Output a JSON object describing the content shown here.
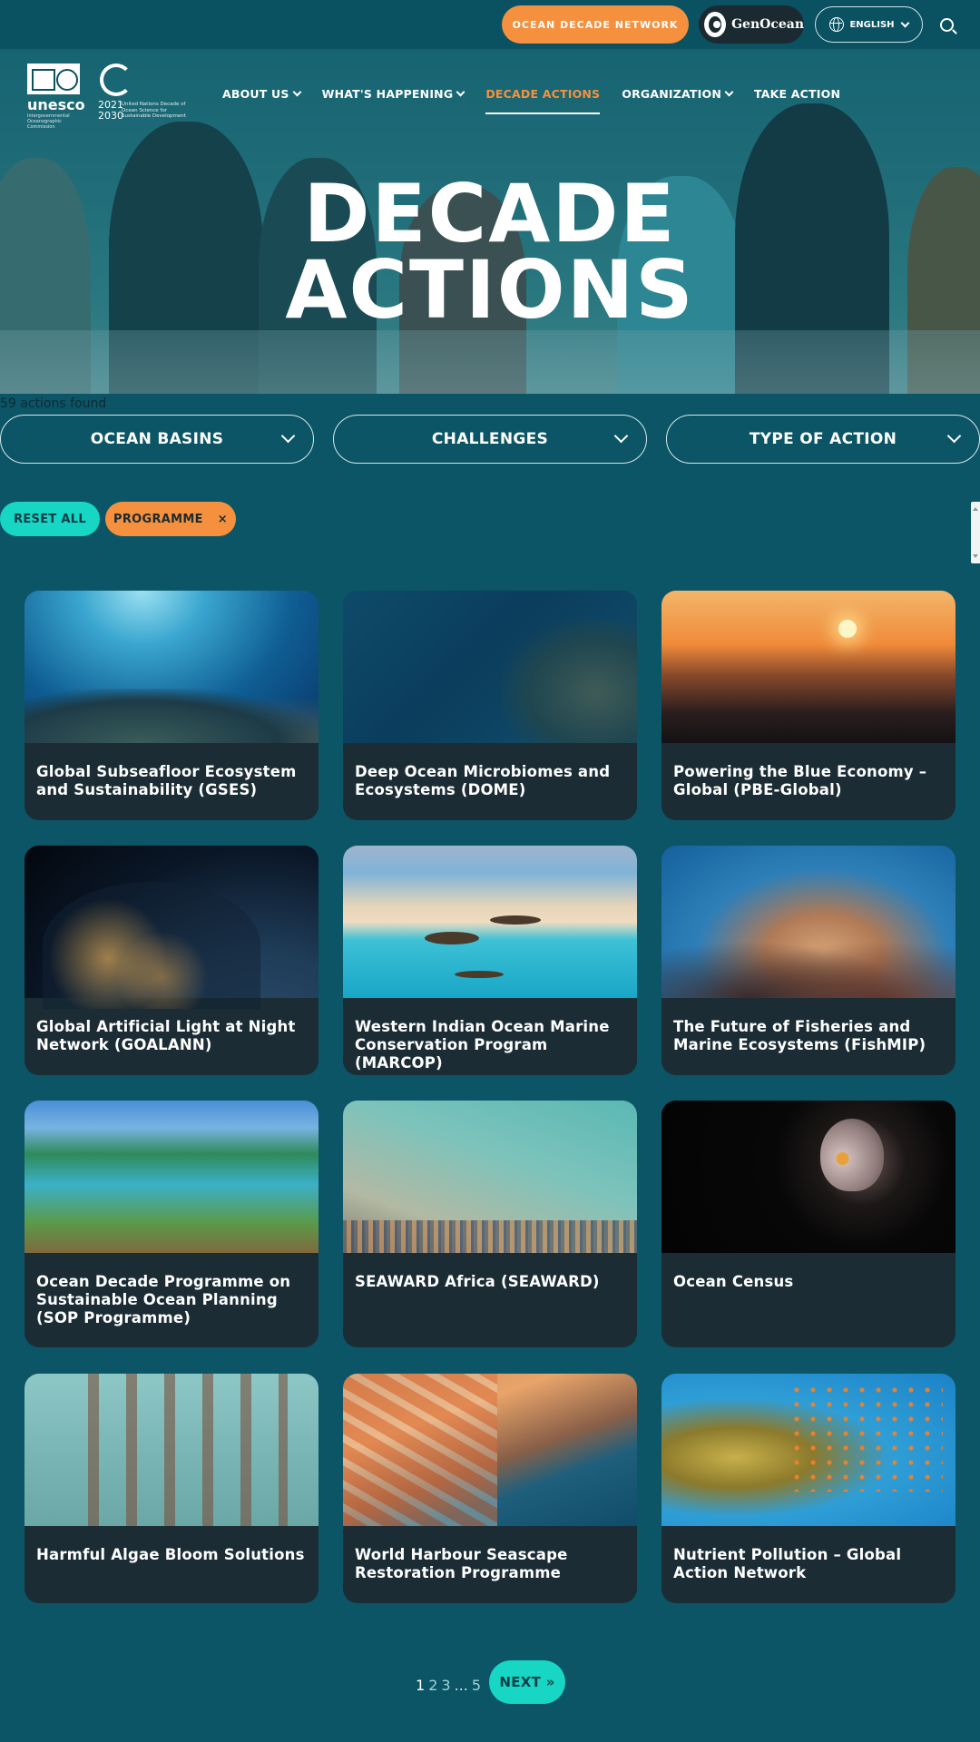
{
  "topbar": {
    "network_label": "OCEAN DECADE NETWORK",
    "genocean_label": "GenOcean",
    "language_label": "ENGLISH"
  },
  "logos": {
    "unesco_word": "unesco",
    "unesco_sub": "Intergovernmental Oceanographic Commission",
    "decade_years_1": "2021",
    "decade_years_2": "2030",
    "decade_tagline": "United Nations Decade of Ocean Science for Sustainable Development"
  },
  "nav": {
    "items": [
      {
        "label": "ABOUT US",
        "has_menu": true
      },
      {
        "label": "WHAT'S HAPPENING",
        "has_menu": true
      },
      {
        "label": "DECADE ACTIONS",
        "has_menu": false,
        "active": true
      },
      {
        "label": "ORGANIZATION",
        "has_menu": true
      },
      {
        "label": "TAKE ACTION",
        "has_menu": false
      }
    ]
  },
  "hero": {
    "title_line1": "DECADE",
    "title_line2": "ACTIONS"
  },
  "results": {
    "count_text": "59 actions found"
  },
  "filters": {
    "dropdowns": [
      "OCEAN BASINS",
      "CHALLENGES",
      "TYPE OF ACTION"
    ],
    "reset_label": "RESET ALL",
    "active_tag": "PROGRAMME",
    "remove_symbol": "×"
  },
  "cards": [
    {
      "title": "Global Subseafloor Ecosystem and Sustainability (GSES)"
    },
    {
      "title": "Deep Ocean Microbiomes and Ecosystems (DOME)"
    },
    {
      "title": "Powering the Blue Economy – Global (PBE-Global)"
    },
    {
      "title": "Global Artificial Light at Night Network (GOALANN)"
    },
    {
      "title": "Western Indian Ocean Marine Conservation Program (MARCOP)"
    },
    {
      "title": "The Future of Fisheries and Marine Ecosystems (FishMIP)"
    },
    {
      "title": "Ocean Decade Programme on Sustainable Ocean Planning (SOP Programme)"
    },
    {
      "title": "SEAWARD Africa (SEAWARD)"
    },
    {
      "title": "Ocean Census"
    },
    {
      "title": "Harmful Algae Bloom Solutions"
    },
    {
      "title": "World Harbour Seascape Restoration Programme"
    },
    {
      "title": "Nutrient Pollution – Global Action Network"
    }
  ],
  "pagination": {
    "current": "1",
    "pages": [
      "2",
      "3"
    ],
    "ellipsis": "...",
    "last": "5",
    "next_label": "NEXT »"
  },
  "colors": {
    "background": "#0b5566",
    "accent_orange": "#f5913e",
    "accent_teal": "#17d6c4",
    "card": "#1b2c34"
  }
}
